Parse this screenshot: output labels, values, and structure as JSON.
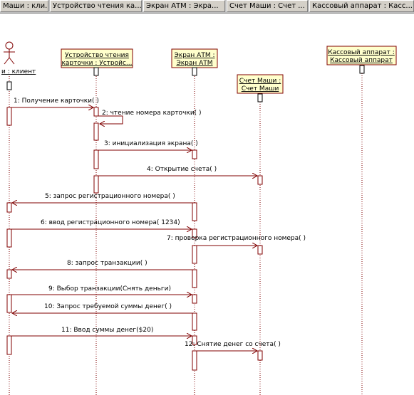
{
  "tabs": [
    {
      "label": "Маши : кли..."
    },
    {
      "label": "Устройство чтения ка..."
    },
    {
      "label": "Экран АТМ : Экра..."
    },
    {
      "label": "Счет Маши : Счет ..."
    },
    {
      "label": "Кассовый аппарат : Касс..."
    }
  ],
  "actor": {
    "label": "и : клиент"
  },
  "objects": [
    {
      "line1": "Устройство чтения",
      "line2": "карточки : Устройс..."
    },
    {
      "line1": "Экран АТМ :",
      "line2": "Экран АТМ"
    },
    {
      "line1": "Счет Маши :",
      "line2": "Счет Маши"
    },
    {
      "line1": "Кассовый аппарат :",
      "line2": "Кассовый аппарат"
    }
  ],
  "messages": [
    {
      "label": "1: Получение карточки( )"
    },
    {
      "label": "2: чтение номера карточки( )"
    },
    {
      "label": "3: инициализация экрана( )"
    },
    {
      "label": "4: Открытие счета( )"
    },
    {
      "label": "5: запрос регистрационного номера( )"
    },
    {
      "label": "6: ввод регистрационного номера( 1234)"
    },
    {
      "label": "7: проверка регистрационного номера( )"
    },
    {
      "label": "8: запрос транзакции( )"
    },
    {
      "label": "9: Выбор транзакции(Снять деньги)"
    },
    {
      "label": "10: Запрос требуемой суммы денег( )"
    },
    {
      "label": "11: Ввод суммы денег($20)"
    },
    {
      "label": "12: Снятие денег со счета( )"
    }
  ],
  "colors": {
    "line": "#800000",
    "note_fill": "#ffffcc",
    "text": "#000000",
    "arrow": "#800000"
  }
}
